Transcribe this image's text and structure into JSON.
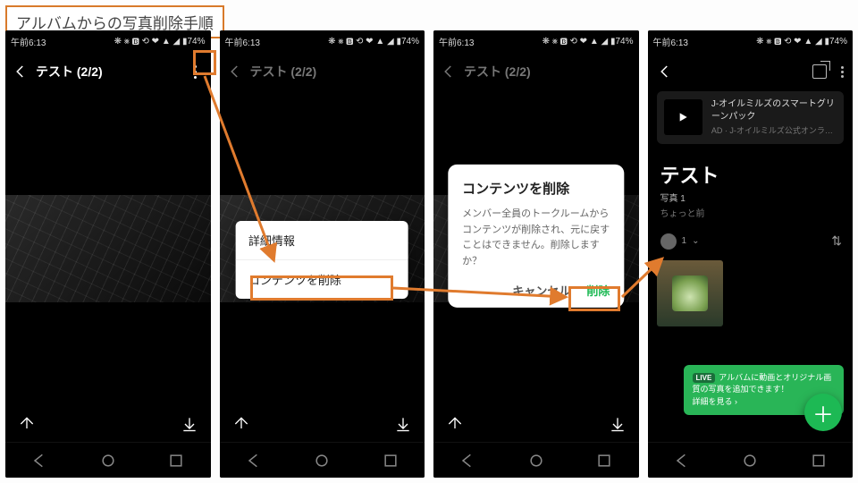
{
  "caption": "アルバムからの写真削除手順",
  "status": {
    "time": "午前6:13",
    "icons": "◎ △ ⊞",
    "right": "❋ ⨳ 🅱 ⟲ ❤ ▲ ◢ ▮74%"
  },
  "screen1": {
    "title": "テスト (2/2)"
  },
  "screen2": {
    "title": "テスト (2/2)",
    "menu": {
      "item1": "詳細情報",
      "item2": "コンテンツを削除"
    }
  },
  "screen3": {
    "title": "テスト (2/2)",
    "dialog": {
      "heading": "コンテンツを削除",
      "body": "メンバー全員のトークルームからコンテンツが削除され、元に戻すことはできません。削除しますか？",
      "cancel": "キャンセル",
      "confirm": "削除"
    }
  },
  "screen4": {
    "ad": {
      "title": "J-オイルミルズのスマートグリーンパック",
      "sub": "AD · J-オイルミルズ公式オンラ…"
    },
    "album": {
      "title": "テスト",
      "count": "写真 1",
      "time": "ちょっと前",
      "author": "1"
    },
    "toast": {
      "badge": "LIVE",
      "line1": "アルバムに動画とオリジナル画質の写真を追加できます！",
      "line2": "詳細を見る ›"
    }
  }
}
